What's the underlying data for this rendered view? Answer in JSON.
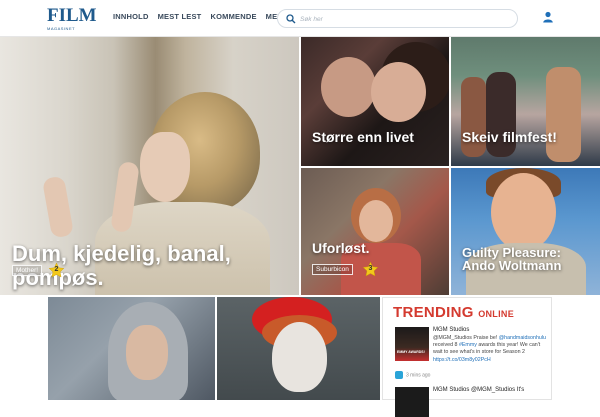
{
  "header": {
    "logo_text": "FILM",
    "logo_sub": "MAGASINET",
    "nav": [
      {
        "label": "INNHOLD"
      },
      {
        "label": "MEST LEST"
      },
      {
        "label": "KOMMENDE"
      },
      {
        "label": "MER"
      }
    ],
    "search_placeholder": "Søk her"
  },
  "tiles": {
    "main": {
      "title_line1": "Dum, kjedelig, banal,",
      "title_line2": "pompøs.",
      "tag": "Mother!",
      "rating": "2"
    },
    "a": {
      "title": "Større enn livet"
    },
    "b": {
      "title": "Skeiv filmfest!"
    },
    "c": {
      "title": "Uforløst.",
      "tag": "Suburbicon",
      "rating": "3"
    },
    "d": {
      "title_line1": "Guilty Pleasure:",
      "title_line2": "Ando Woltmann"
    }
  },
  "trending": {
    "title": "TRENDING",
    "subtitle": "ONLINE",
    "tweets": [
      {
        "user": "MGM Studios",
        "handle": "@MGM_Studios",
        "text_prefix": "Praise be!",
        "mention": "@handmaidsonhulu",
        "text_mid": "received 8",
        "hashtag": "#Emmy",
        "text_rest": "awards this year! We can't wait to see what's in store for Season 2",
        "link": "https://t.co/03m8y02PcH",
        "time": "3 mins ago",
        "thumb_label": "EMMY AWARDS!"
      },
      {
        "user": "MGM Studios",
        "handle": "@MGM_Studios",
        "text": "It's"
      }
    ]
  },
  "colors": {
    "brand_blue": "#1f5a8c",
    "trending_red": "#d43a2f",
    "star_yellow": "#f2c81b"
  }
}
